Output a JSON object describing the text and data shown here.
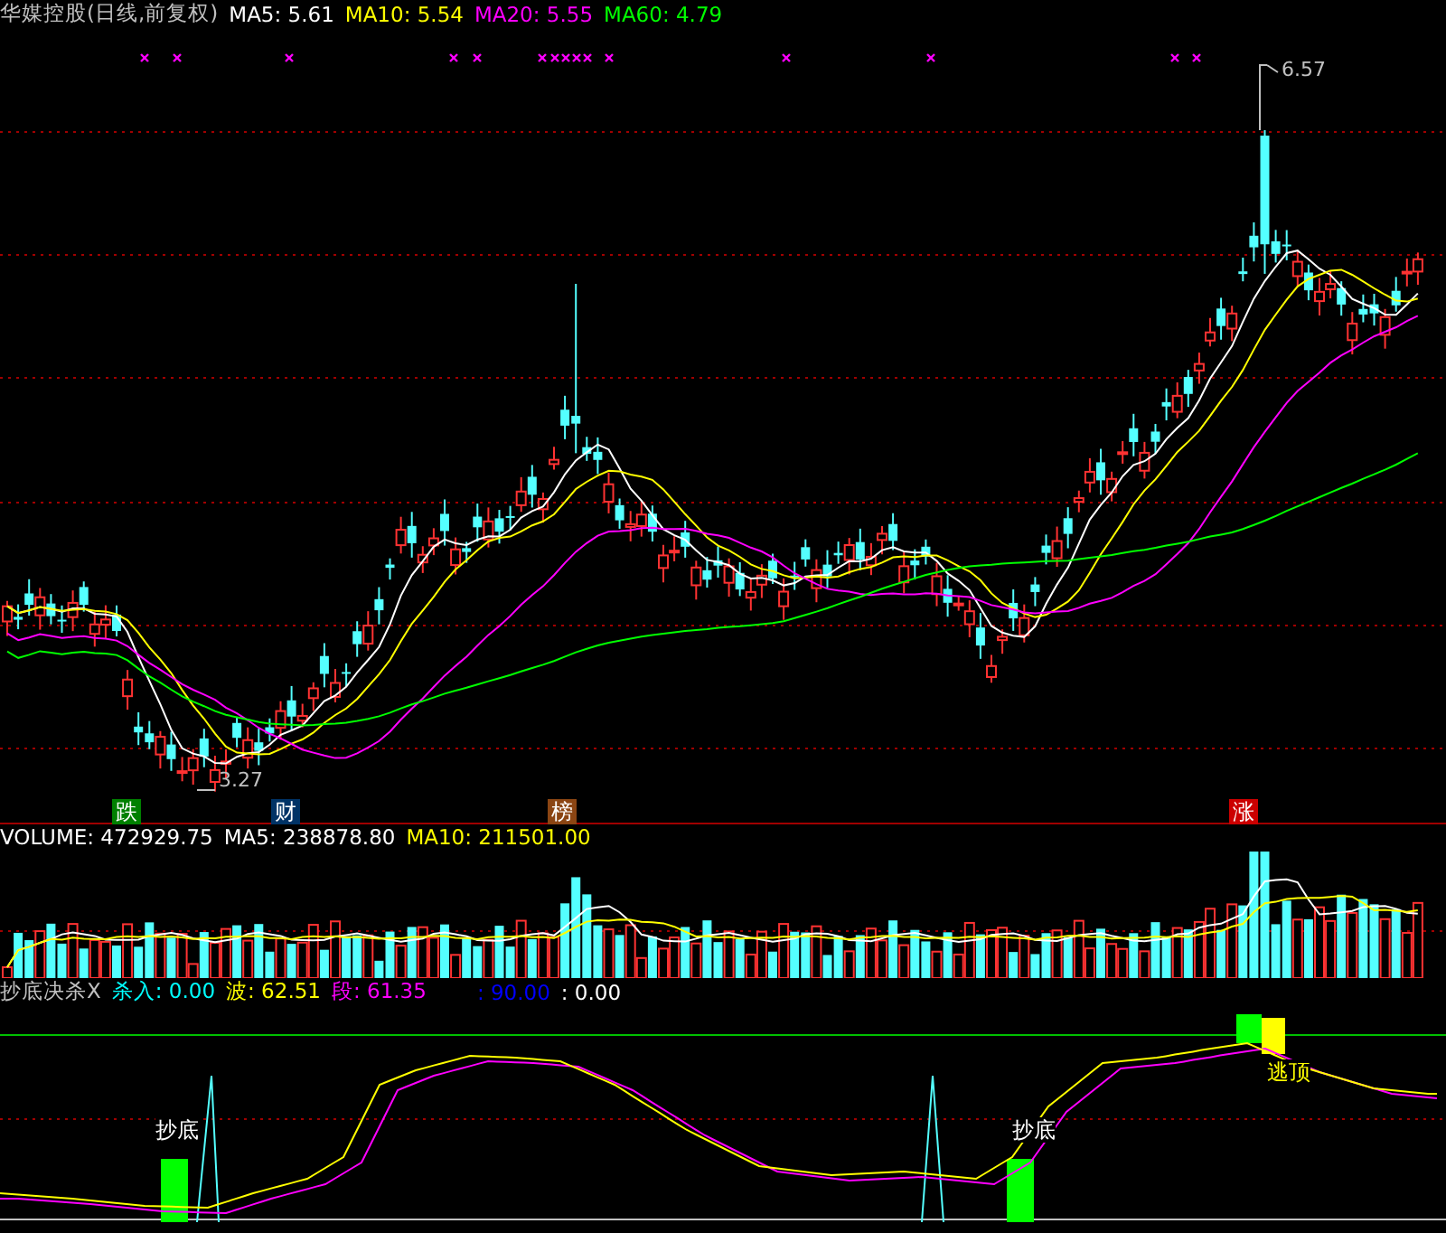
{
  "chart_title": "华媒控股(日线,前复权)",
  "ma_legend": [
    {
      "label": "MA5: 5.61",
      "color": "#ffffff"
    },
    {
      "label": "MA10: 5.54",
      "color": "#ffff00"
    },
    {
      "label": "MA20: 5.55",
      "color": "#ff00ff"
    },
    {
      "label": "MA60: 4.79",
      "color": "#00ff00"
    }
  ],
  "price_labels": [
    {
      "kind": "high",
      "text": "6.57"
    },
    {
      "kind": "low",
      "text": "3.27"
    }
  ],
  "event_tags": [
    {
      "text": "跌",
      "color": "#008000"
    },
    {
      "text": "财",
      "color": "#003366"
    },
    {
      "text": "榜",
      "color": "#8b4513"
    },
    {
      "text": "涨",
      "color": "#cc0000"
    }
  ],
  "volume_legend": [
    {
      "label": "VOLUME: 472929.75",
      "color": "#ffffff"
    },
    {
      "label": "MA5: 238878.80",
      "color": "#ffffff"
    },
    {
      "label": "MA10: 211501.00",
      "color": "#ffff00"
    }
  ],
  "indicator_legend": [
    {
      "label": "抄底决杀X",
      "color": "#c0c0c0"
    },
    {
      "label": "杀入: 0.00",
      "color": "#00ffff"
    },
    {
      "label": "波: 62.51",
      "color": "#ffff00"
    },
    {
      "label": "段: 61.35",
      "color": "#ff00ff"
    },
    {
      "label": ": 90.00",
      "color": "#0000ff"
    },
    {
      "label": ": 0.00",
      "color": "#ffffff"
    }
  ],
  "signals": [
    {
      "kind": "buy",
      "text": "抄底"
    },
    {
      "kind": "buy",
      "text": "抄底"
    },
    {
      "kind": "sell",
      "text": "逃顶"
    }
  ]
}
